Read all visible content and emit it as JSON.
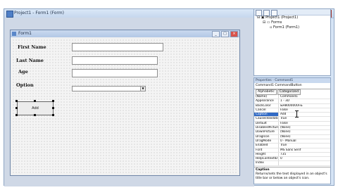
{
  "window": {
    "title": "Project1 - Form1 (Form)",
    "buttons": [
      "_",
      "□",
      "×"
    ]
  },
  "form": {
    "title": "Form1",
    "buttons": [
      "_",
      "□",
      "×"
    ],
    "labels": {
      "first_name": "First Name",
      "last_name": "Last Name",
      "age": "Age",
      "option": "Option"
    },
    "command_button": "Add"
  },
  "project": {
    "root": "Project1 (Project1)",
    "folder": "Forms",
    "item": "Form1 (Form1)"
  },
  "properties": {
    "title": "Properties - Command1",
    "object": "Command1  CommandButton",
    "tabs": [
      "Alphabetic",
      "Categorized"
    ],
    "rows": [
      {
        "name": "(Name)",
        "value": "Command1"
      },
      {
        "name": "Appearance",
        "value": "1 - 3D"
      },
      {
        "name": "BackColor",
        "value": "&H8000000F&"
      },
      {
        "name": "Cancel",
        "value": "False"
      },
      {
        "name": "Caption",
        "value": "Add"
      },
      {
        "name": "CausesValidation",
        "value": "True"
      },
      {
        "name": "Default",
        "value": "False"
      },
      {
        "name": "DisabledPicture",
        "value": "(None)"
      },
      {
        "name": "DownPicture",
        "value": "(None)"
      },
      {
        "name": "DragIcon",
        "value": "(None)"
      },
      {
        "name": "DragMode",
        "value": "0 - Manual"
      },
      {
        "name": "Enabled",
        "value": "True"
      },
      {
        "name": "Font",
        "value": "MS Sans Serif"
      },
      {
        "name": "Height",
        "value": "735"
      },
      {
        "name": "HelpContextID",
        "value": "0"
      },
      {
        "name": "Index",
        "value": ""
      }
    ],
    "selected_row": "Caption",
    "description_title": "Caption",
    "description_text": "Returns/sets the text displayed in an object's title bar or below an object's icon."
  }
}
